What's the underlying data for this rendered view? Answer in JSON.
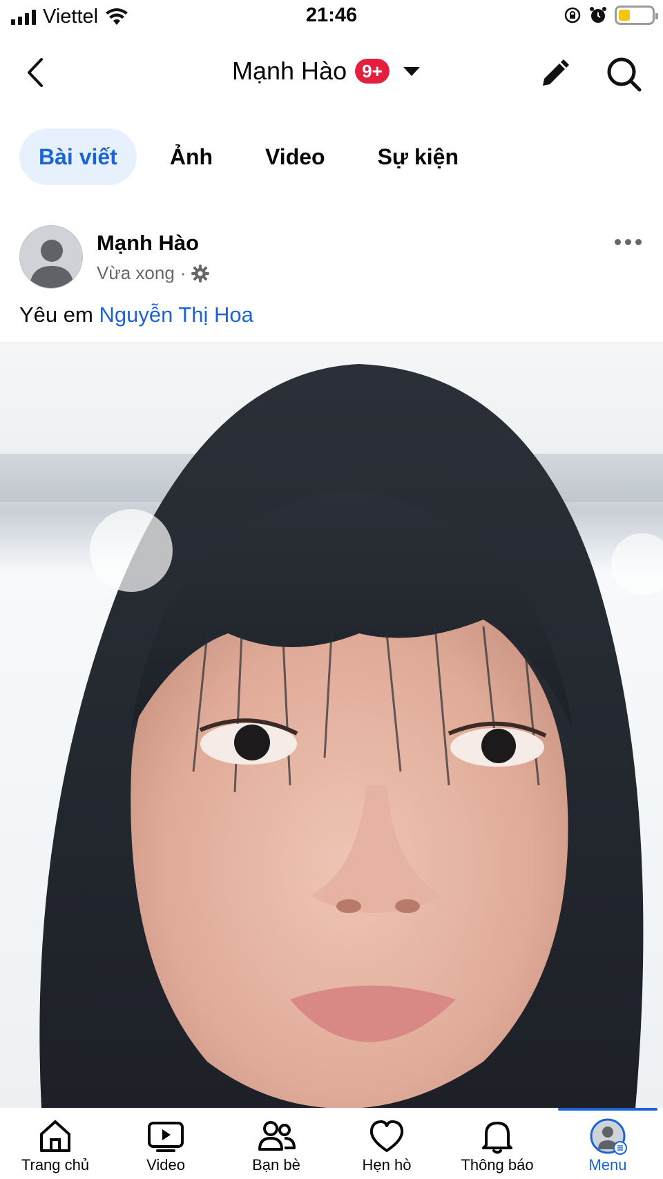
{
  "status_bar": {
    "carrier": "Viettel",
    "time": "21:46",
    "icons": [
      "signal-icon",
      "wifi-icon",
      "rotation-lock-icon",
      "alarm-icon",
      "battery-icon"
    ],
    "battery_level": 0.35,
    "battery_color": "#f6c40f"
  },
  "header": {
    "title": "Mạnh Hào",
    "badge": "9+",
    "badge_color": "#e41e3f",
    "icons": [
      "back-chevron-icon",
      "caret-down-icon",
      "pencil-icon",
      "search-icon"
    ]
  },
  "tabs": [
    {
      "label": "Bài viết",
      "active": true
    },
    {
      "label": "Ảnh",
      "active": false
    },
    {
      "label": "Video",
      "active": false
    },
    {
      "label": "Sự kiện",
      "active": false
    }
  ],
  "post": {
    "author": "Mạnh Hào",
    "time": "Vừa xong",
    "separator": "·",
    "privacy_icon": "gear-icon",
    "caption_text": "Yêu em ",
    "caption_tag": "Nguyễn Thị Hoa",
    "media": "selfie-photo"
  },
  "bottom_nav": [
    {
      "label": "Trang chủ",
      "icon": "home-icon",
      "active": false
    },
    {
      "label": "Video",
      "icon": "video-icon",
      "active": false
    },
    {
      "label": "Bạn bè",
      "icon": "friends-icon",
      "active": false
    },
    {
      "label": "Hẹn hò",
      "icon": "dating-heart-icon",
      "active": false
    },
    {
      "label": "Thông báo",
      "icon": "bell-icon",
      "active": false
    },
    {
      "label": "Menu",
      "icon": "menu-avatar-icon",
      "active": true
    }
  ],
  "colors": {
    "accent": "#1b64d6",
    "tab_active_bg": "#e7f0fd",
    "secondary_text": "#65676b"
  }
}
